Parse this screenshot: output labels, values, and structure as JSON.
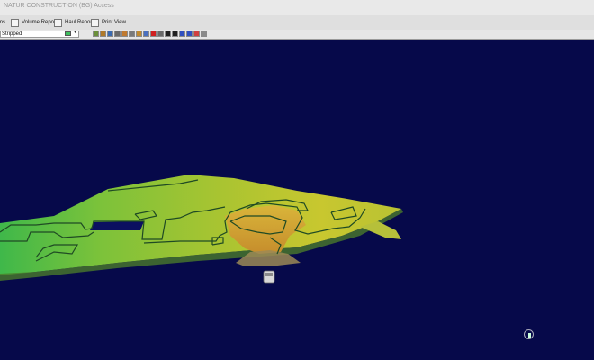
{
  "window": {
    "title": "NATUR CONSTRUCTION (BG) Access"
  },
  "toolbar": {
    "buttons": [
      {
        "label": "ms",
        "icon": "menu-icon"
      },
      {
        "label": "Volume Report",
        "icon": "volume-report-icon"
      },
      {
        "label": "Haul Report",
        "icon": "haul-report-icon"
      },
      {
        "label": "Print View",
        "icon": "print-view-icon"
      }
    ]
  },
  "surface_selector": {
    "value": "Stripped",
    "color": "#3fbf5f"
  },
  "tool_icons": [
    {
      "name": "pan-icon",
      "color": "#6a8f3a"
    },
    {
      "name": "rotate-icon",
      "color": "#b07a2a"
    },
    {
      "name": "zoom-icon",
      "color": "#3a6ab0"
    },
    {
      "name": "zoom-extents-icon",
      "color": "#6a6a6a"
    },
    {
      "name": "select-icon",
      "color": "#c07a30"
    },
    {
      "name": "layer-icon",
      "color": "#7a7a7a"
    },
    {
      "name": "cube-icon",
      "color": "#c08a30"
    },
    {
      "name": "sphere-icon",
      "color": "#4a70c0"
    },
    {
      "name": "record-icon",
      "color": "#d02020"
    },
    {
      "name": "stop-icon",
      "color": "#6a6a6a"
    },
    {
      "name": "play-icon",
      "color": "#202020"
    },
    {
      "name": "pause-icon",
      "color": "#202020"
    },
    {
      "name": "capture-icon",
      "color": "#3050c0"
    },
    {
      "name": "settings-icon",
      "color": "#3050c0"
    },
    {
      "name": "export-icon",
      "color": "#d04040"
    },
    {
      "name": "image-icon",
      "color": "#8a8a8a"
    }
  ],
  "viewport": {
    "background": "#06094a"
  }
}
